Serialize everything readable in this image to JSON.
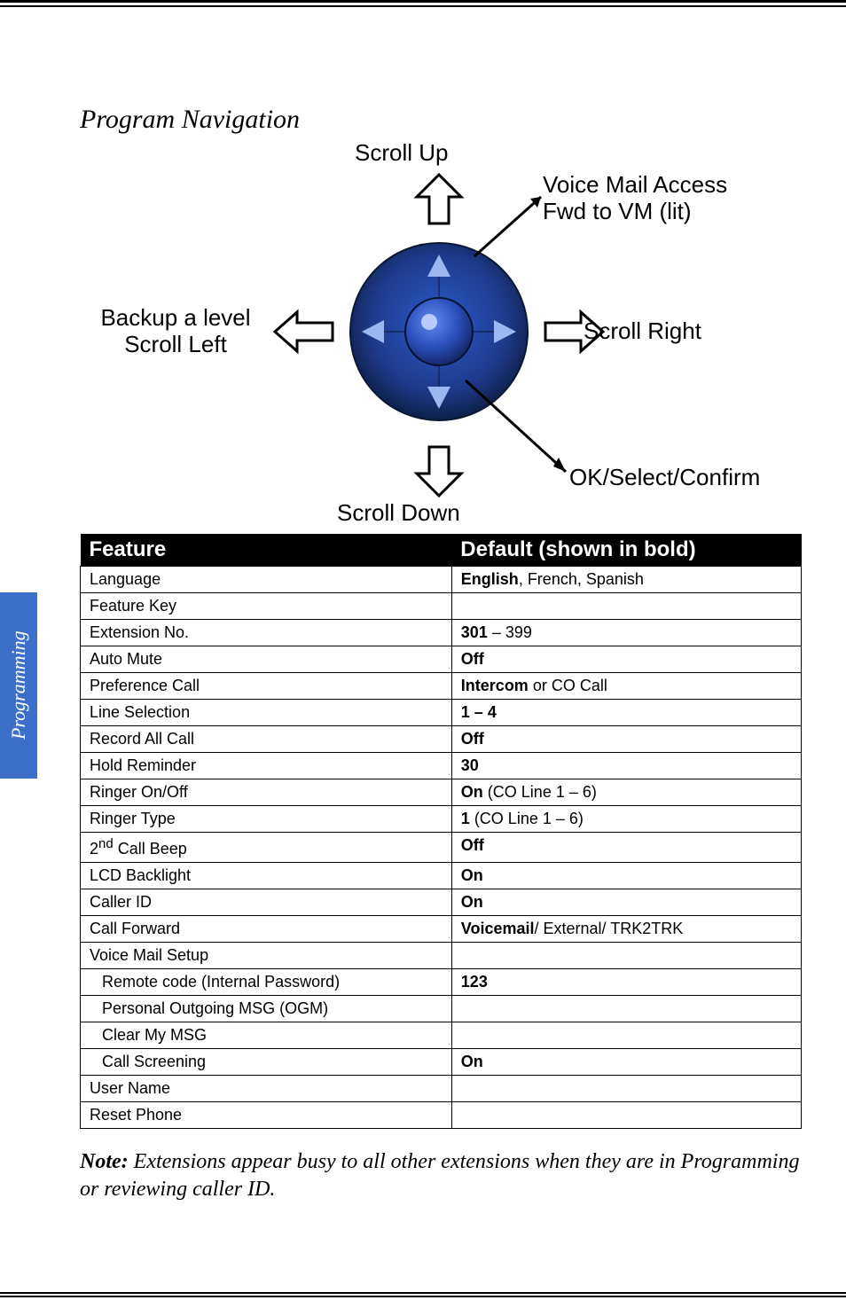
{
  "side_tab": "Programming",
  "section_title": "Program Navigation",
  "diagram": {
    "scroll_up": "Scroll Up",
    "scroll_down": "Scroll Down",
    "backup_left_line1": "Backup a level",
    "backup_left_line2": "Scroll Left",
    "scroll_right": "Scroll Right",
    "vm_access_line1": "Voice Mail Access",
    "vm_access_line2": "Fwd to VM (lit)",
    "ok_select": "OK/Select/Confirm"
  },
  "table": {
    "header_feature": "Feature",
    "header_default": "Default (shown in bold)",
    "rows": [
      {
        "feature": "Language",
        "bold": "English",
        "rest": ", French, Spanish"
      },
      {
        "feature": "Feature Key",
        "bold": "",
        "rest": ""
      },
      {
        "feature": "Extension No.",
        "bold": "301",
        "rest": " – 399"
      },
      {
        "feature": "Auto Mute",
        "bold": "Off",
        "rest": ""
      },
      {
        "feature": "Preference Call",
        "bold": "Intercom",
        "rest": " or CO Call"
      },
      {
        "feature": "Line Selection",
        "bold": "1 – 4",
        "rest": ""
      },
      {
        "feature": "Record All Call",
        "bold": "Off",
        "rest": ""
      },
      {
        "feature": "Hold Reminder",
        "bold": "30",
        "rest": ""
      },
      {
        "feature": "Ringer On/Off",
        "bold": "On",
        "rest": " (CO Line 1 – 6)"
      },
      {
        "feature": "Ringer Type",
        "bold": "1",
        "rest": "   (CO Line 1 – 6)"
      },
      {
        "feature_html": "2<sup>nd</sup> Call Beep",
        "bold": "Off",
        "rest": ""
      },
      {
        "feature": "LCD Backlight",
        "bold": "On",
        "rest": ""
      },
      {
        "feature": "Caller ID",
        "bold": "On",
        "rest": ""
      },
      {
        "feature": "Call Forward",
        "bold": "Voicemail",
        "rest": "/ External/ TRK2TRK"
      },
      {
        "feature": "Voice Mail Setup",
        "bold": "",
        "rest": ""
      },
      {
        "feature": "Remote code (Internal Password)",
        "indent": true,
        "bold": "123",
        "rest": ""
      },
      {
        "feature": "Personal Outgoing MSG (OGM)",
        "indent": true,
        "bold": "",
        "rest": ""
      },
      {
        "feature": "Clear My MSG",
        "indent": true,
        "bold": "",
        "rest": ""
      },
      {
        "feature": "Call Screening",
        "indent": true,
        "bold": "On",
        "rest": ""
      },
      {
        "feature": "User Name",
        "bold": "",
        "rest": ""
      },
      {
        "feature": "Reset Phone",
        "bold": "",
        "rest": ""
      }
    ]
  },
  "note": {
    "lead": "Note:",
    "body": " Extensions appear busy to all other extensions when they are in Programming or reviewing caller ID."
  }
}
